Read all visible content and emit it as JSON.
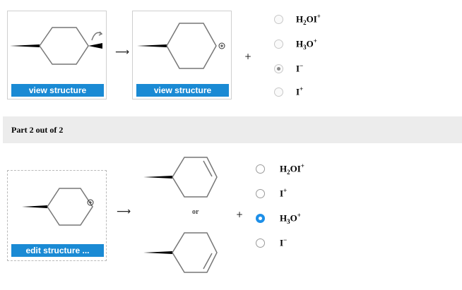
{
  "part1": {
    "card1": {
      "button_label": "view structure"
    },
    "card2": {
      "button_label": "view structure"
    },
    "arrow": "⟶",
    "plus": "+",
    "options": [
      {
        "base": "H",
        "sub": "2",
        "rest": "OI",
        "sup": "+",
        "selected": false
      },
      {
        "base": "H",
        "sub": "3",
        "rest": "O",
        "sup": "+",
        "selected": false
      },
      {
        "base": "I",
        "sub": "",
        "rest": "",
        "sup": "−",
        "selected": true
      },
      {
        "base": "I",
        "sub": "",
        "rest": "",
        "sup": "+",
        "selected": false
      }
    ]
  },
  "part2": {
    "header": "Part 2 out of 2",
    "card": {
      "button_label": "edit structure ..."
    },
    "arrow": "⟶",
    "or_label": "or",
    "plus": "+",
    "options": [
      {
        "base": "H",
        "sub": "2",
        "rest": "OI",
        "sup": "+",
        "selected": false
      },
      {
        "base": "I",
        "sub": "",
        "rest": "",
        "sup": "+",
        "selected": false
      },
      {
        "base": "H",
        "sub": "3",
        "rest": "O",
        "sup": "+",
        "selected": true
      },
      {
        "base": "I",
        "sub": "",
        "rest": "",
        "sup": "−",
        "selected": false
      }
    ]
  },
  "colors": {
    "accent": "#1a8ad4",
    "radio_selected": "#1d8fe8",
    "band": "#ececec"
  }
}
